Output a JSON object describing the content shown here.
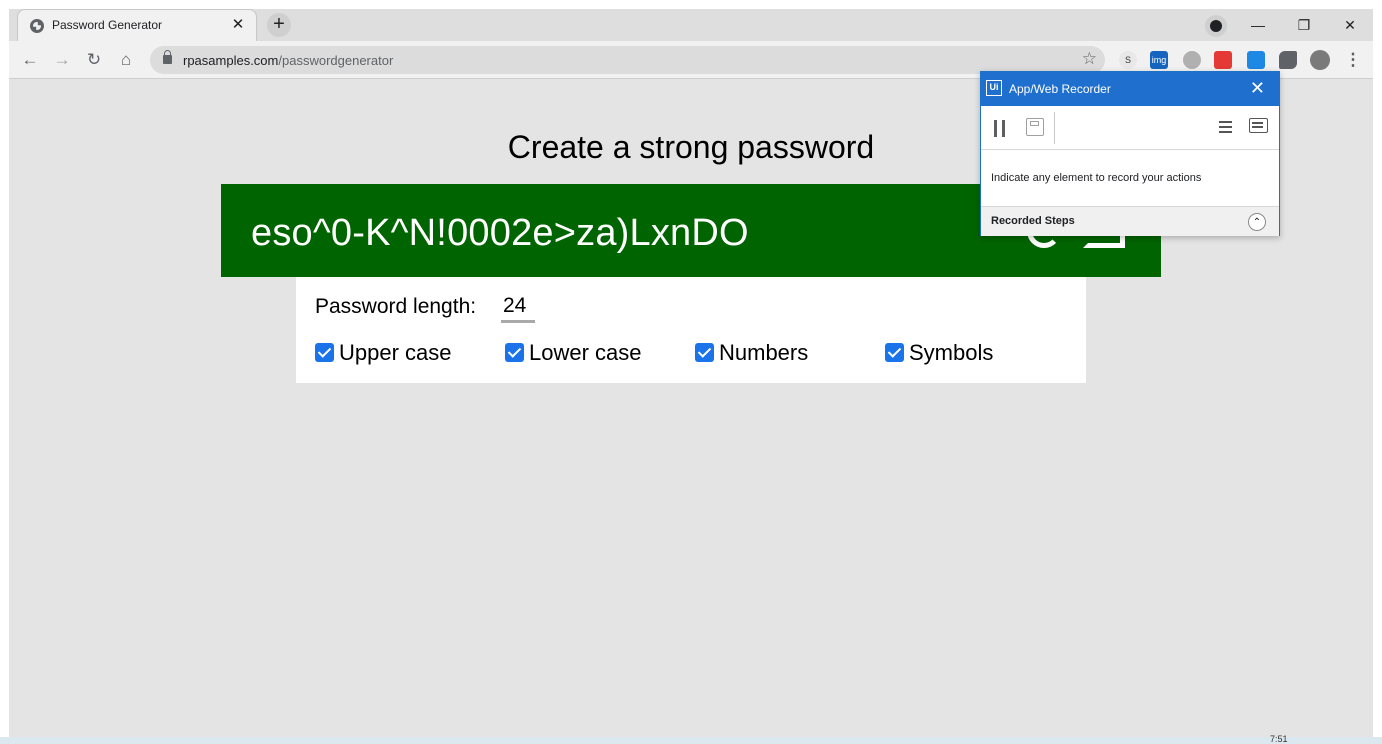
{
  "browser": {
    "tab_title": "Password Generator",
    "tab_close": "✕",
    "new_tab": "+",
    "url_host": "rpasamples.com",
    "url_path": "/passwordgenerator",
    "window_minimize": "—",
    "window_restore": "❐",
    "window_close": "✕",
    "nav": {
      "back": "←",
      "forward": "→",
      "reload": "↻",
      "home": "⌂"
    },
    "bookmark_star": "☆",
    "extensions": [
      {
        "icon": "s-extension-icon",
        "label": "S",
        "color": "#e8e8e8"
      },
      {
        "icon": "img-extension-icon",
        "label": "img",
        "color": "#1565c0"
      },
      {
        "icon": "circle-extension-icon",
        "label": "",
        "color": "#9e9e9e"
      },
      {
        "icon": "red-extension-icon",
        "label": "",
        "color": "#e53935"
      },
      {
        "icon": "uipath-extension-icon",
        "label": "",
        "color": "#1e88e5"
      },
      {
        "icon": "puzzle-icon",
        "label": "",
        "color": "#5f6368"
      },
      {
        "icon": "avatar-icon",
        "label": "",
        "color": "#7a7a7a"
      }
    ],
    "menu": "⋮"
  },
  "page": {
    "headline": "Create a strong password",
    "password": "eso^0-K^N!0002e>za)LxnDO",
    "length_label": "Password length:",
    "length_value": "24",
    "options": [
      {
        "label": "Upper case",
        "checked": true
      },
      {
        "label": "Lower case",
        "checked": true
      },
      {
        "label": "Numbers",
        "checked": true
      },
      {
        "label": "Symbols",
        "checked": true
      }
    ],
    "accent_color": "#006400"
  },
  "recorder": {
    "logo": "Ui",
    "title": "App/Web Recorder",
    "close": "✕",
    "hint": "Indicate any element to record your actions",
    "steps_label": "Recorded Steps",
    "steps_toggle": "⌃",
    "accent_color": "#1f6fce"
  },
  "taskbar": {
    "clock": "7:51"
  }
}
